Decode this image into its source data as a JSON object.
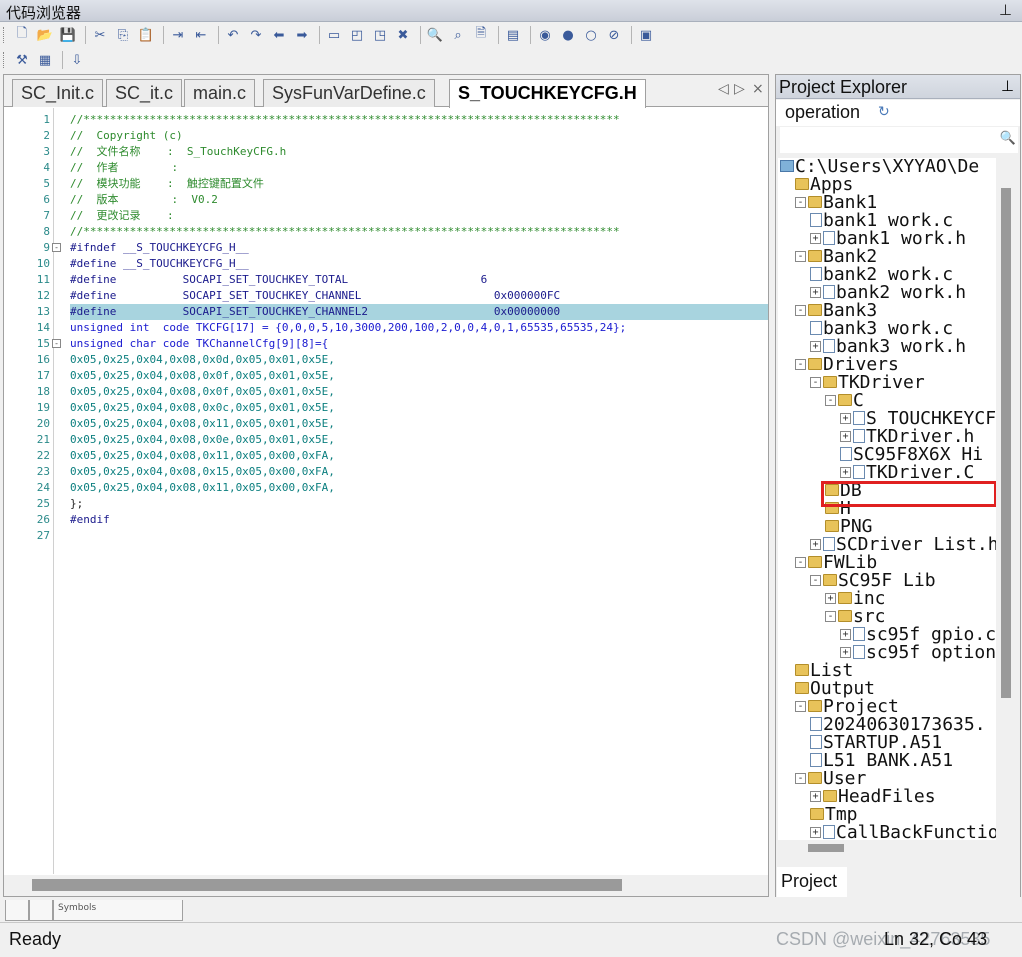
{
  "window": {
    "title": "代码浏览器",
    "pin_glyph": "٢"
  },
  "toolbar1": {
    "items": [
      "new-file",
      "open-file",
      "save",
      "sep",
      "cut",
      "copy",
      "paste",
      "sep",
      "indent",
      "unindent",
      "sep",
      "undo",
      "redo",
      "back",
      "forward",
      "sep",
      "bookmark",
      "prev-bookmark",
      "next-bookmark",
      "clear-bookmark",
      "sep",
      "find",
      "find-next",
      "find-in-files",
      "sep",
      "browse",
      "sep",
      "debug",
      "breakpoint",
      "disable-bp",
      "kill-bp",
      "sep",
      "window"
    ]
  },
  "toolbar2": {
    "items": [
      "build",
      "rebuild",
      "sep",
      "load"
    ]
  },
  "editor": {
    "tabs": [
      {
        "label": "SC_Init.c",
        "active": false
      },
      {
        "label": "SC_it.c",
        "active": false
      },
      {
        "label": "main.c",
        "active": false
      },
      {
        "label": "SysFunVarDefine.c",
        "active": false
      },
      {
        "label": "S_TOUCHKEYCFG.H",
        "active": true
      }
    ],
    "tab_nav_left": "◁",
    "tab_nav_right": "▷",
    "tab_nav_close": "×",
    "lines": [
      {
        "n": "1",
        "t": "//*********************************************************************************",
        "cls": "c-comment"
      },
      {
        "n": "2",
        "t": "//  Copyright (c)",
        "cls": "c-comment"
      },
      {
        "n": "3",
        "t": "//  文件名称    :  S_TouchKeyCFG.h",
        "cls": "c-comment"
      },
      {
        "n": "4",
        "t": "//  作者        :",
        "cls": "c-comment"
      },
      {
        "n": "5",
        "t": "//  模块功能    :  触控键配置文件",
        "cls": "c-comment"
      },
      {
        "n": "6",
        "t": "//  版本        :  V0.2",
        "cls": "c-comment"
      },
      {
        "n": "7",
        "t": "//  更改记录    :",
        "cls": "c-comment"
      },
      {
        "n": "8",
        "t": "//*********************************************************************************",
        "cls": "c-comment"
      },
      {
        "n": "9",
        "t": "#ifndef __S_TOUCHKEYCFG_H__",
        "cls": "c-pre",
        "fold": "-"
      },
      {
        "n": "10",
        "t": "#define __S_TOUCHKEYCFG_H__",
        "cls": "c-pre"
      },
      {
        "n": "11",
        "t": "#define          SOCAPI_SET_TOUCHKEY_TOTAL                    6",
        "cls": "c-pre"
      },
      {
        "n": "12",
        "t": "#define          SOCAPI_SET_TOUCHKEY_CHANNEL                    0x000000FC",
        "cls": "c-pre"
      },
      {
        "n": "13",
        "t": "#define          SOCAPI_SET_TOUCHKEY_CHANNEL2                   0x00000000",
        "cls": "c-pre",
        "hl": true
      },
      {
        "n": "14",
        "t": "unsigned int  code TKCFG[17] = {0,0,0,5,10,3000,200,100,2,0,0,4,0,1,65535,65535,24};",
        "cls": "c-kw"
      },
      {
        "n": "15",
        "t": "unsigned char code TKChannelCfg[9][8]={",
        "cls": "c-kw",
        "fold": "-"
      },
      {
        "n": "16",
        "t": "0x05,0x25,0x04,0x08,0x0d,0x05,0x01,0x5E,",
        "cls": "c-num"
      },
      {
        "n": "17",
        "t": "0x05,0x25,0x04,0x08,0x0f,0x05,0x01,0x5E,",
        "cls": "c-num"
      },
      {
        "n": "18",
        "t": "0x05,0x25,0x04,0x08,0x0f,0x05,0x01,0x5E,",
        "cls": "c-num"
      },
      {
        "n": "19",
        "t": "0x05,0x25,0x04,0x08,0x0c,0x05,0x01,0x5E,",
        "cls": "c-num"
      },
      {
        "n": "20",
        "t": "0x05,0x25,0x04,0x08,0x11,0x05,0x01,0x5E,",
        "cls": "c-num"
      },
      {
        "n": "21",
        "t": "0x05,0x25,0x04,0x08,0x0e,0x05,0x01,0x5E,",
        "cls": "c-num"
      },
      {
        "n": "22",
        "t": "0x05,0x25,0x04,0x08,0x11,0x05,0x00,0xFA,",
        "cls": "c-num"
      },
      {
        "n": "23",
        "t": "0x05,0x25,0x04,0x08,0x15,0x05,0x00,0xFA,",
        "cls": "c-num"
      },
      {
        "n": "24",
        "t": "0x05,0x25,0x04,0x08,0x11,0x05,0x00,0xFA,",
        "cls": "c-num"
      },
      {
        "n": "25",
        "t": "};",
        "cls": "c-plain"
      },
      {
        "n": "26",
        "t": "#endif",
        "cls": "c-pre"
      },
      {
        "n": "27",
        "t": "",
        "cls": "c-plain"
      }
    ]
  },
  "project_explorer": {
    "title": "Project Explorer",
    "operation_label": "operation",
    "search_placeholder": "",
    "tab_label": "Project",
    "tree": [
      {
        "label": "C:\\Users\\XYYAO\\De",
        "depth": 0,
        "icon": "drive",
        "exp": ""
      },
      {
        "label": "Apps",
        "depth": 1,
        "icon": "folder",
        "exp": ""
      },
      {
        "label": "Bank1",
        "depth": 1,
        "icon": "folder",
        "exp": "-"
      },
      {
        "label": "bank1 work.c",
        "depth": 2,
        "icon": "file",
        "exp": ""
      },
      {
        "label": "bank1 work.h",
        "depth": 2,
        "icon": "file",
        "exp": "+"
      },
      {
        "label": "Bank2",
        "depth": 1,
        "icon": "folder",
        "exp": "-"
      },
      {
        "label": "bank2 work.c",
        "depth": 2,
        "icon": "file",
        "exp": ""
      },
      {
        "label": "bank2 work.h",
        "depth": 2,
        "icon": "file",
        "exp": "+"
      },
      {
        "label": "Bank3",
        "depth": 1,
        "icon": "folder",
        "exp": "-"
      },
      {
        "label": "bank3 work.c",
        "depth": 2,
        "icon": "file",
        "exp": ""
      },
      {
        "label": "bank3 work.h",
        "depth": 2,
        "icon": "file",
        "exp": "+"
      },
      {
        "label": "Drivers",
        "depth": 1,
        "icon": "folder",
        "exp": "-"
      },
      {
        "label": "TKDriver",
        "depth": 2,
        "icon": "folder",
        "exp": "-"
      },
      {
        "label": "C",
        "depth": 3,
        "icon": "folder",
        "exp": "-"
      },
      {
        "label": "S TOUCHKEYCF",
        "depth": 4,
        "icon": "file",
        "exp": "+"
      },
      {
        "label": "TKDriver.h",
        "depth": 4,
        "icon": "file",
        "exp": "+"
      },
      {
        "label": "SC95F8X6X Hi",
        "depth": 4,
        "icon": "file",
        "exp": ""
      },
      {
        "label": "TKDriver.C",
        "depth": 4,
        "icon": "file",
        "exp": "+"
      },
      {
        "label": "DB",
        "depth": 3,
        "icon": "folder",
        "exp": ""
      },
      {
        "label": "H",
        "depth": 3,
        "icon": "folder",
        "exp": ""
      },
      {
        "label": "PNG",
        "depth": 3,
        "icon": "folder",
        "exp": ""
      },
      {
        "label": "SCDriver List.h",
        "depth": 2,
        "icon": "file",
        "exp": "+"
      },
      {
        "label": "FWLib",
        "depth": 1,
        "icon": "folder",
        "exp": "-"
      },
      {
        "label": "SC95F Lib",
        "depth": 2,
        "icon": "folder",
        "exp": "-"
      },
      {
        "label": "inc",
        "depth": 3,
        "icon": "folder",
        "exp": "+"
      },
      {
        "label": "src",
        "depth": 3,
        "icon": "folder",
        "exp": "-"
      },
      {
        "label": "sc95f gpio.c",
        "depth": 4,
        "icon": "file",
        "exp": "+"
      },
      {
        "label": "sc95f option",
        "depth": 4,
        "icon": "file",
        "exp": "+"
      },
      {
        "label": "List",
        "depth": 1,
        "icon": "folder",
        "exp": ""
      },
      {
        "label": "Output",
        "depth": 1,
        "icon": "folder",
        "exp": ""
      },
      {
        "label": "Project",
        "depth": 1,
        "icon": "folder",
        "exp": "-"
      },
      {
        "label": "20240630173635.",
        "depth": 2,
        "icon": "file",
        "exp": ""
      },
      {
        "label": "STARTUP.A51",
        "depth": 2,
        "icon": "file",
        "exp": ""
      },
      {
        "label": "L51 BANK.A51",
        "depth": 2,
        "icon": "file",
        "exp": ""
      },
      {
        "label": "User",
        "depth": 1,
        "icon": "folder",
        "exp": "-"
      },
      {
        "label": "HeadFiles",
        "depth": 2,
        "icon": "folder",
        "exp": "+"
      },
      {
        "label": "Tmp",
        "depth": 2,
        "icon": "folder",
        "exp": ""
      },
      {
        "label": "CallBackFunctio",
        "depth": 2,
        "icon": "file",
        "exp": "+"
      }
    ]
  },
  "bottom_panel": {
    "tabs": [
      "",
      "",
      "Symbols"
    ]
  },
  "statusbar": {
    "ready": "Ready",
    "position": "Ln 32, Co 43",
    "watermark": "CSDN @weixin_42763535"
  },
  "colors": {
    "highlight": "#a8d4df",
    "annotation_box": "#e02020"
  }
}
